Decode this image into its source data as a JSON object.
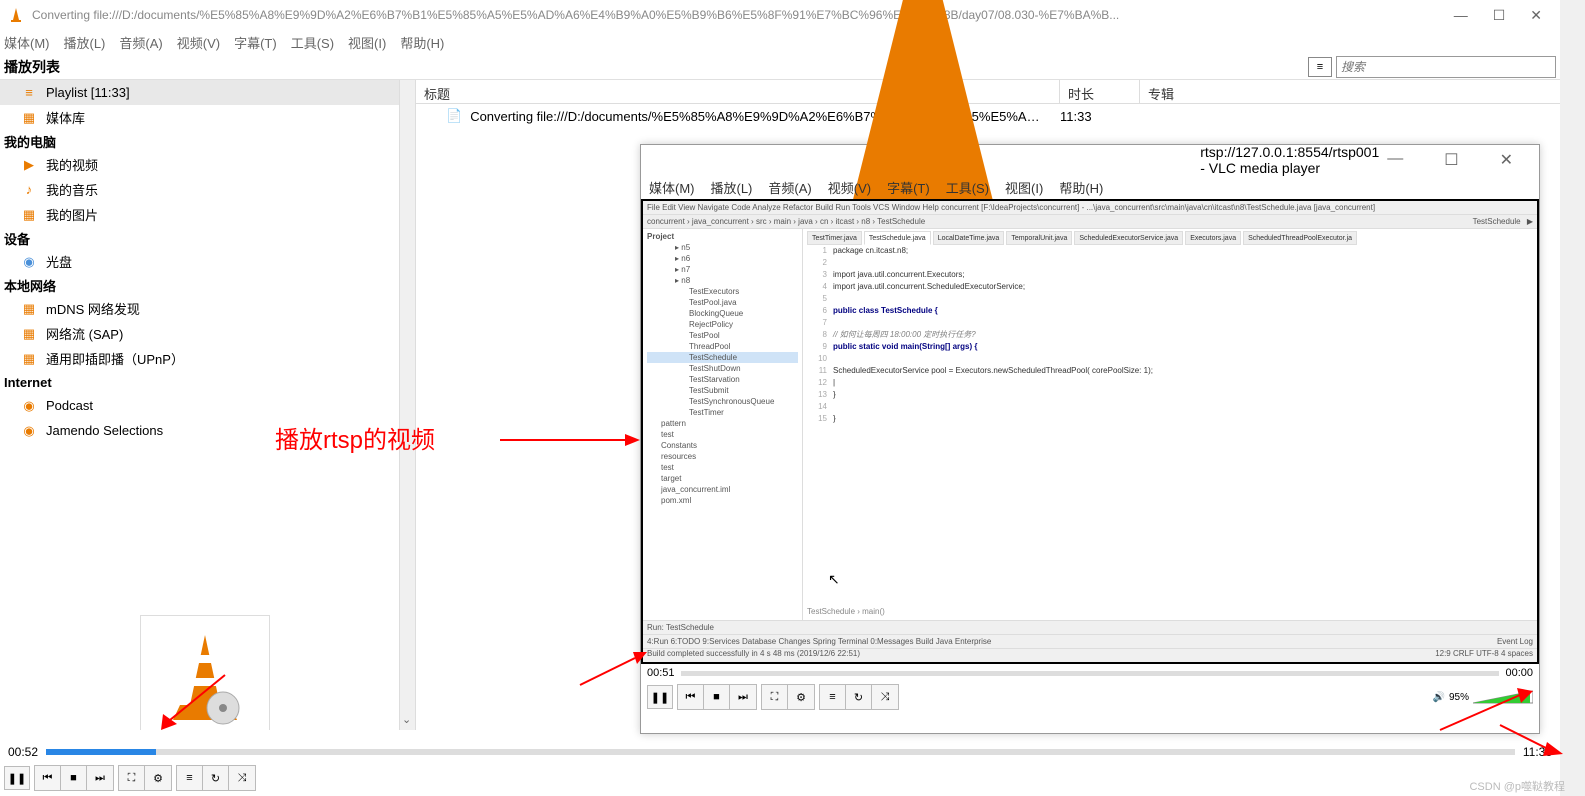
{
  "mainWindow": {
    "title": "Converting file:///D:/documents/%E5%85%A8%E9%9D%A2%E6%B7%B1%E5%85%A5%E5%AD%A6%E4%B9%A0%E5%B9%B6%E5%8F%91%E7%BC%96%E7%A8%8B/day07/08.030-%E7%BA%B...",
    "menu": [
      "媒体(M)",
      "播放(L)",
      "音频(A)",
      "视频(V)",
      "字幕(T)",
      "工具(S)",
      "视图(I)",
      "帮助(H)"
    ],
    "playlistHeader": "播放列表",
    "searchPlaceholder": "搜索",
    "columns": {
      "title": "标题",
      "duration": "时长",
      "album": "专辑"
    },
    "playlist": {
      "rowTitle": "Converting file:///D:/documents/%E5%85%A8%E9%9D%A2%E6%B7%B1%E5%85%A5%E5%A…",
      "rowDuration": "11:33"
    },
    "sidebar": {
      "playlist": "Playlist [11:33]",
      "mediaLib": "媒体库",
      "myComputer": "我的电脑",
      "myVideos": "我的视频",
      "myMusic": "我的音乐",
      "myPictures": "我的图片",
      "devices": "设备",
      "disc": "光盘",
      "localNetwork": "本地网络",
      "mdns": "mDNS 网络发现",
      "sap": "网络流 (SAP)",
      "upnp": "通用即插即播（UPnP）",
      "internet": "Internet",
      "podcast": "Podcast",
      "jamendo": "Jamendo Selections"
    },
    "timeElapsed": "00:52",
    "timeTotal": "11:33",
    "progressPercent": 7.5
  },
  "innerWindow": {
    "title": "rtsp://127.0.0.1:8554/rtsp001 - VLC media player",
    "menu": [
      "媒体(M)",
      "播放(L)",
      "音频(A)",
      "视频(V)",
      "字幕(T)",
      "工具(S)",
      "视图(I)",
      "帮助(H)"
    ],
    "timeElapsed": "00:51",
    "timeTotal": "00:00",
    "volume": "95%",
    "ide": {
      "topMenu": "File  Edit  View  Navigate  Code  Analyze  Refactor  Build  Run  Tools  VCS  Window  Help    concurrent [F:\\IdeaProjects\\concurrent] - ...\\java_concurrent\\src\\main\\java\\cn\\itcast\\n8\\TestSchedule.java [java_concurrent]",
      "breadcrumb": "concurrent › java_concurrent › src › main › java › cn › itcast › n8 › TestSchedule",
      "runConfig": "TestSchedule",
      "projectLabel": "Project",
      "tree": [
        "n5",
        "n6",
        "n7",
        "n8",
        "TestExecutors",
        "TestPool.java",
        "BlockingQueue",
        "RejectPolicy",
        "TestPool",
        "ThreadPool",
        "TestSchedule",
        "TestShutDown",
        "TestStarvation",
        "TestSubmit",
        "TestSynchronousQueue",
        "TestTimer",
        "pattern",
        "test",
        "Constants",
        "resources",
        "test",
        "target",
        "java_concurrent.iml",
        "pom.xml"
      ],
      "tabs": [
        "TestTimer.java",
        "TestSchedule.java",
        "LocalDateTime.java",
        "TemporalUnit.java",
        "ScheduledExecutorService.java",
        "Executors.java",
        "ScheduledThreadPoolExecutor.ja"
      ],
      "activeTab": 1,
      "code": [
        {
          "ln": "1",
          "txt": "package cn.itcast.n8;",
          "cls": ""
        },
        {
          "ln": "2",
          "txt": "",
          "cls": ""
        },
        {
          "ln": "3",
          "txt": "import java.util.concurrent.Executors;",
          "cls": ""
        },
        {
          "ln": "4",
          "txt": "import java.util.concurrent.ScheduledExecutorService;",
          "cls": ""
        },
        {
          "ln": "5",
          "txt": "",
          "cls": ""
        },
        {
          "ln": "6",
          "txt": "public class TestSchedule {",
          "cls": "kw"
        },
        {
          "ln": "7",
          "txt": "",
          "cls": ""
        },
        {
          "ln": "8",
          "txt": "    // 如何让每周四 18:00:00 定时执行任务?",
          "cls": "cm"
        },
        {
          "ln": "9",
          "txt": "    public static void main(String[] args) {",
          "cls": "kw"
        },
        {
          "ln": "10",
          "txt": "",
          "cls": ""
        },
        {
          "ln": "11",
          "txt": "        ScheduledExecutorService pool = Executors.newScheduledThreadPool( corePoolSize: 1);",
          "cls": ""
        },
        {
          "ln": "12",
          "txt": "        |",
          "cls": ""
        },
        {
          "ln": "13",
          "txt": "    }",
          "cls": ""
        },
        {
          "ln": "14",
          "txt": "",
          "cls": ""
        },
        {
          "ln": "15",
          "txt": "}",
          "cls": ""
        }
      ],
      "breadcrumb2": "TestSchedule › main()",
      "bottomTabs": "4:Run  6:TODO  9:Services  Database Changes  Spring  Terminal  0:Messages  Build  Java Enterprise",
      "runTab": "Run:  TestSchedule",
      "status": "Build completed successfully in 4 s 48 ms (2019/12/6 22:51)",
      "statusRight": "12:9  CRLF  UTF-8  4 spaces",
      "eventLog": "Event Log"
    }
  },
  "annotation": "播放rtsp的视频",
  "watermark": "CSDN @p噬鞑教程"
}
